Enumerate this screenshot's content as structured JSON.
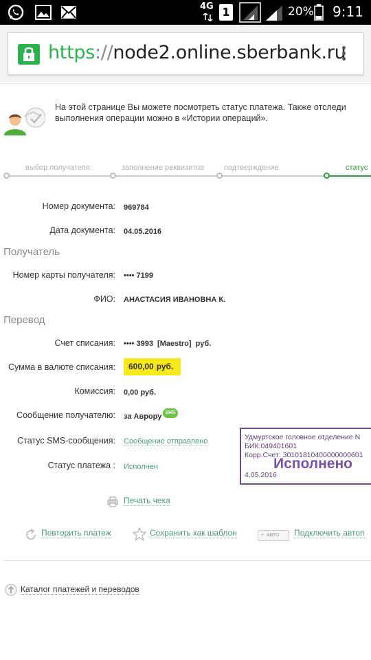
{
  "status_bar": {
    "network": "4G",
    "sim_slot": "1",
    "battery": "20%",
    "time": "9:11"
  },
  "browser": {
    "url_scheme": "https",
    "url_sep": "://",
    "url_host": "node2.online.sberbank.ru"
  },
  "info": {
    "line1": "На этой странице Вы можете посмотреть статус платежа. Также отследи",
    "line2": "выполнения операции можно в «Истории операций»."
  },
  "steps": [
    {
      "label": "выбор получателя"
    },
    {
      "label": "заполнение реквизитов"
    },
    {
      "label": "подтверждение"
    },
    {
      "label": "статус"
    }
  ],
  "document": {
    "number_label": "Номер документа:",
    "number_value": "969784",
    "date_label": "Дата документа:",
    "date_value": "04.05.2016"
  },
  "recipient": {
    "section_title": "Получатель",
    "card_label": "Номер карты получателя:",
    "card_value": "•••• 7199",
    "name_label": "ФИО:",
    "name_value": "АНАСТАСИЯ ИВАНОВНА К."
  },
  "transfer": {
    "section_title": "Перевод",
    "account_label": "Счет списания:",
    "account_value": "•••• 3993  [Maestro]  руб.",
    "amount_label": "Сумма в валюте списания:",
    "amount_value": "600,00",
    "amount_unit": "руб.",
    "fee_label": "Комиссия:",
    "fee_value": "0,00 руб.",
    "message_label": "Сообщение получателю:",
    "message_value": "за Аврору",
    "sms_badge": "SMS",
    "sms_status_label": "Статус SMS-сообщения:",
    "sms_status_value": "Сообщение отправлено",
    "payment_status_label": "Статус платежа :",
    "payment_status_value": "Исполнен"
  },
  "stamp": {
    "line1": "Удмуртское головное отделение N",
    "line2": "БИК:049401601",
    "line3": "Корр.Счет: 30101810400000000601",
    "status": "Исполнено",
    "date": "4.05.2016"
  },
  "actions": {
    "print": "Печать чека",
    "repeat": "Повторить платеж",
    "save_template": "Сохранить как шаблон",
    "auto_badge": "АВТО",
    "autopay": "Подключить автоп"
  },
  "catalog": "Каталог платежей и переводов",
  "colors": {
    "accent": "#2e9e3a",
    "link": "#4a9a7a",
    "highlight": "#f7e81c",
    "stamp": "#6f4c8f"
  }
}
